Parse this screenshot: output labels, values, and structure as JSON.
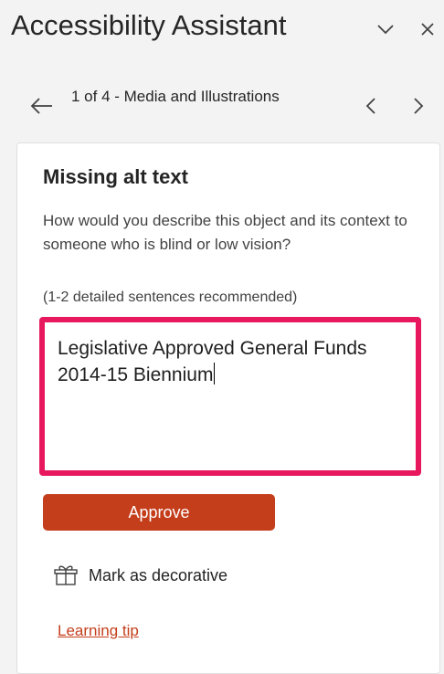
{
  "header": {
    "title": "Accessibility Assistant",
    "collapse_icon": "chevron-down-icon",
    "close_icon": "close-icon"
  },
  "nav": {
    "position_label": "1 of 4 - Media and Illustrations",
    "back_icon": "arrow-left-icon",
    "prev_icon": "chevron-left-icon",
    "next_icon": "chevron-right-icon"
  },
  "issue": {
    "title": "Missing alt text",
    "description": "How would you describe this object and its context to someone who is blind or low vision?",
    "hint": "(1-2 detailed sentences recommended)",
    "alt_text_value": "Legislative Approved General Funds 2014-15 Biennium"
  },
  "actions": {
    "approve_label": "Approve",
    "decorative_label": "Mark as decorative",
    "decorative_icon": "ribbon-icon",
    "learning_tip_label": "Learning tip"
  },
  "colors": {
    "accent": "#c43e1c",
    "highlight_border": "#e8185f",
    "panel_bg": "#f3f3f3",
    "card_bg": "#ffffff"
  }
}
